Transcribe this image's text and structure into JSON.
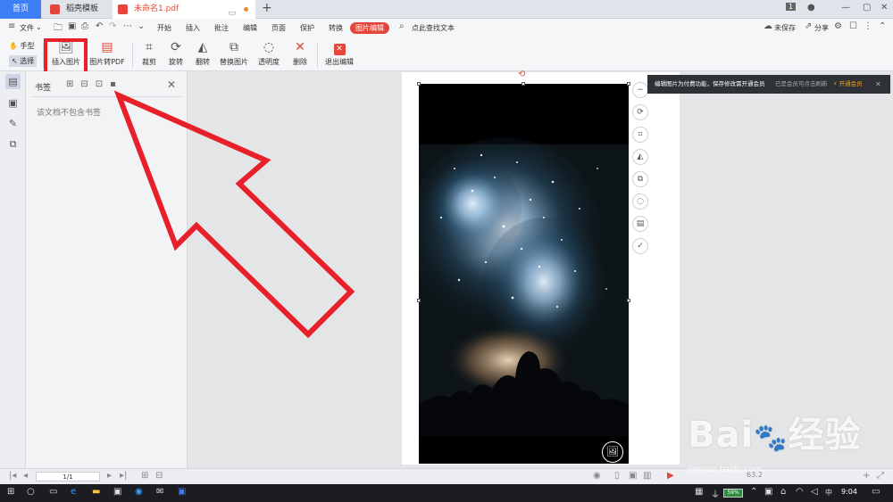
{
  "tabs": {
    "home": "首页",
    "template": "稻壳模板",
    "document": "未命名1.pdf",
    "page_count": "1"
  },
  "menu": {
    "file": "文件",
    "items": [
      "开始",
      "插入",
      "批注",
      "编辑",
      "页面",
      "保护",
      "转换"
    ],
    "active": "图片编辑",
    "search": "点此查找文本",
    "unsaved": "未保存",
    "share": "分享"
  },
  "toolbar": {
    "hand": "手型",
    "select": "选择",
    "insert_image": "插入图片",
    "image_to_pdf": "图片转PDF",
    "crop": "裁剪",
    "rotate": "旋转",
    "flip": "翻转",
    "replace_image": "替换图片",
    "transparency": "透明度",
    "delete": "删除",
    "exit_edit": "退出编辑"
  },
  "bookmark_panel": {
    "title": "书签",
    "empty_message": "该文档不包含书签"
  },
  "notification": {
    "message": "编辑图片为付费功能，保存修改需开通会员",
    "refresh_hint": "已是会员可点击刷新",
    "upgrade": "开通会员"
  },
  "status": {
    "page_indicator": "1/1",
    "zoom": "63.2"
  },
  "taskbar": {
    "battery": "59%",
    "lang": "中",
    "time": "9:04"
  },
  "watermark": {
    "brand": "Bai",
    "brand_cn": "经验",
    "url": "jingyan.baidu.com"
  },
  "colors": {
    "accent": "#e5453a",
    "home_tab": "#3d7df5",
    "highlight_box": "#e8202a"
  }
}
